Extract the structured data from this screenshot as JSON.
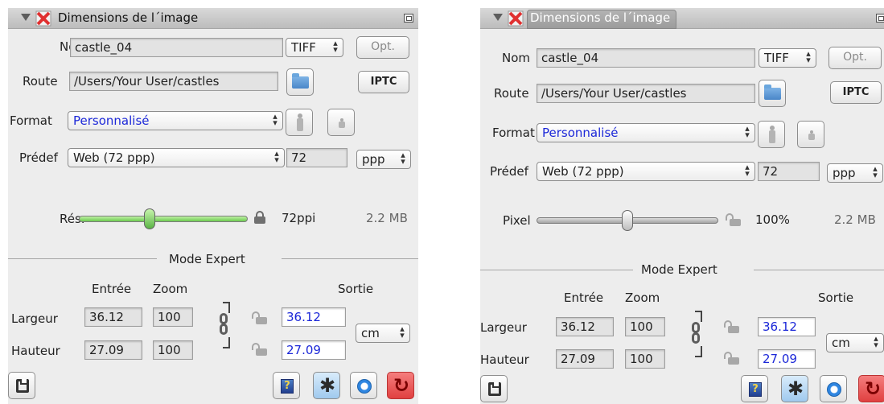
{
  "panels": [
    {
      "title": "Dimensions de l´image",
      "name_label": "Nom",
      "name_value": "castle_04",
      "file_type": "TIFF",
      "options_button": "Opt.",
      "route_label": "Route",
      "route_value": "/Users/Your User/castles",
      "iptc_button": "IPTC",
      "format_label": "Format",
      "format_value": "Personnalisé",
      "preset_label": "Prédef",
      "preset_value": "Web (72 ppp)",
      "resolution_value": "72",
      "resolution_unit": "ppp",
      "slider_label": "Rés.",
      "slider_fraction": 0.42,
      "slider_readout": "72ppi",
      "file_size": "2.2 MB",
      "mode_label": "Mode Expert",
      "input_header": "Entrée",
      "zoom_header": "Zoom",
      "output_header": "Sortie",
      "width_label": "Largeur",
      "height_label": "Hauteur",
      "width_input": "36.12",
      "height_input": "27.09",
      "width_zoom": "100",
      "height_zoom": "100",
      "width_output": "36.12",
      "height_output": "27.09",
      "output_unit": "cm"
    },
    {
      "title": "Dimensions de l´image",
      "name_label": "Nom",
      "name_value": "castle_04",
      "file_type": "TIFF",
      "options_button": "Opt.",
      "route_label": "Route",
      "route_value": "/Users/Your User/castles",
      "iptc_button": "IPTC",
      "format_label": "Format",
      "format_value": "Personnalisé",
      "preset_label": "Prédef",
      "preset_value": "Web (72 ppp)",
      "resolution_value": "72",
      "resolution_unit": "ppp",
      "slider_label": "Pixel",
      "slider_fraction": 0.5,
      "slider_readout": "100%",
      "file_size": "2.2 MB",
      "mode_label": "Mode Expert",
      "input_header": "Entrée",
      "zoom_header": "Zoom",
      "output_header": "Sortie",
      "width_label": "Largeur",
      "height_label": "Hauteur",
      "width_input": "36.12",
      "height_input": "27.09",
      "width_zoom": "100",
      "height_zoom": "100",
      "width_output": "36.12",
      "height_output": "27.09",
      "output_unit": "cm"
    }
  ],
  "icons": {
    "collapse": "disclosure-triangle-icon",
    "app": "red-x-app-icon",
    "detach": "detach-panel-icon",
    "folder": "folder-icon",
    "portrait": "portrait-orientation-icon",
    "landscape": "landscape-orientation-icon",
    "lock": "lock-icon",
    "chain": "chain-link-icon",
    "save": "floppy-disk-icon",
    "help": "help-book-icon",
    "settings": "gear-icon",
    "search": "magnifier-icon",
    "reset": "reset-icon"
  },
  "colors": {
    "blue_value": "#1c28d8",
    "slider_green": "#6ccb50",
    "reset_red": "#e04040"
  }
}
